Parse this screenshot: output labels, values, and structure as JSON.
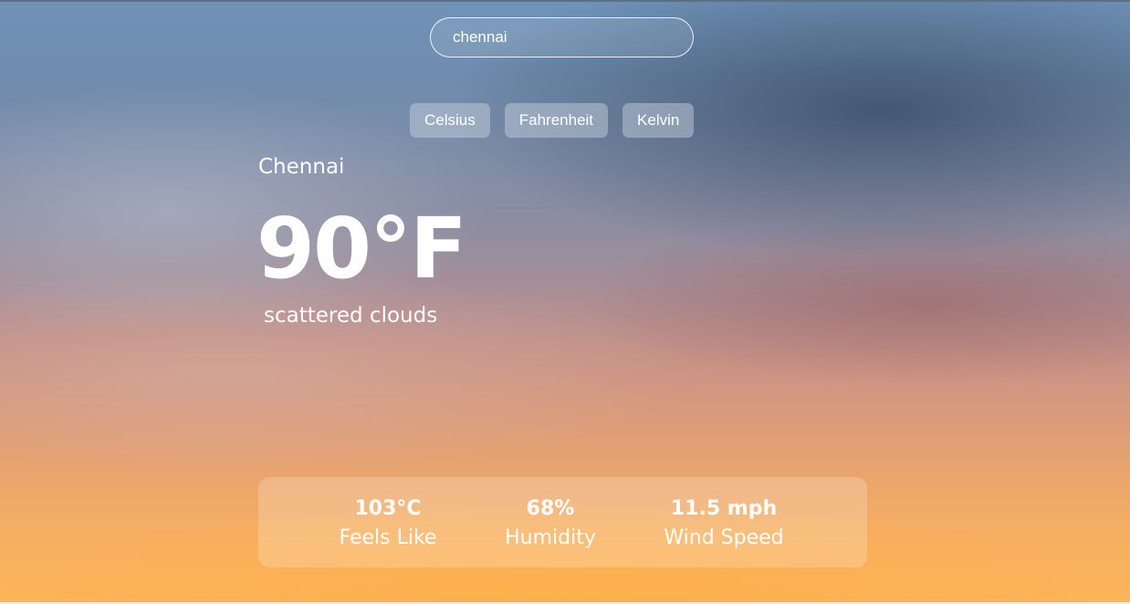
{
  "search": {
    "value": "chennai"
  },
  "units": [
    {
      "label": "Celsius"
    },
    {
      "label": "Fahrenheit"
    },
    {
      "label": "Kelvin"
    }
  ],
  "weather": {
    "city": "Chennai",
    "temperature": "90°F",
    "description": "scattered clouds"
  },
  "details": {
    "feels_like": {
      "value": "103°C",
      "label": "Feels Like"
    },
    "humidity": {
      "value": "68%",
      "label": "Humidity"
    },
    "wind_speed": {
      "value": "11.5 mph",
      "label": "Wind Speed"
    }
  }
}
